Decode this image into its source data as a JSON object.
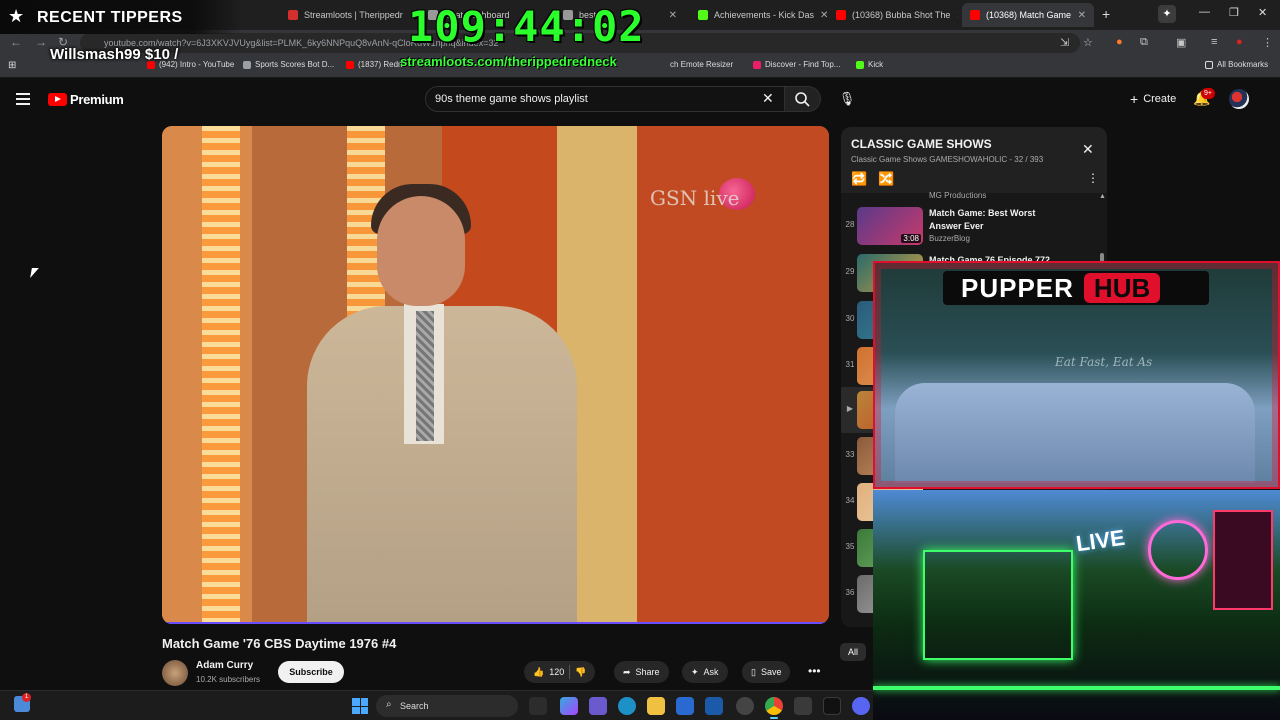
{
  "browser": {
    "tabs": [
      {
        "title": "Streamloots | Therippedr",
        "color": "#d32f2f",
        "active": false
      },
      {
        "title": "Chat  Dashboard",
        "color": "#999999",
        "active": false
      },
      {
        "title": "best C",
        "color": "#999999",
        "active": false
      },
      {
        "title": "Achievements - Kick Das",
        "color": "#53fc18",
        "active": false
      },
      {
        "title": "(10368) Bubba Shot The",
        "color": "#ff0000",
        "active": false
      },
      {
        "title": "(10368) Match Game",
        "color": "#ff0000",
        "active": true
      }
    ],
    "url": "youtube.com/watch?v=6J3XKVJVUyg&list=PLMK_6ky6NNPquQ8vAnN-qCloRdW1npnq&index=32",
    "bookmarks": [
      {
        "label": "(942) Intro - YouTube",
        "color": "#ff0000"
      },
      {
        "label": "Sports Scores Bot D...",
        "color": "#9aa0a6"
      },
      {
        "label": "(1837) Redm",
        "color": "#ff0000"
      },
      {
        "label": "ch Emote Resizer",
        "color": "#9aa0a6"
      },
      {
        "label": "Discover - Find Top...",
        "color": "#e91e63"
      },
      {
        "label": "Kick",
        "color": "#53fc18"
      }
    ],
    "all_bookmarks": "All Bookmarks"
  },
  "youtube": {
    "brand": "Premium",
    "search_value": "90s theme game shows playlist",
    "create_label": "Create",
    "notif_count": "9+"
  },
  "video": {
    "title": "Match Game '76 CBS Daytime 1976 #4",
    "watermark": "GSN live",
    "channel": "Adam Curry",
    "subscribers": "10.2K subscribers",
    "subscribe_label": "Subscribe",
    "likes": "120",
    "share_label": "Share",
    "ask_label": "Ask",
    "save_label": "Save"
  },
  "playlist": {
    "title": "CLASSIC GAME SHOWS",
    "subtitle": "Classic Game Shows GAMESHOWAHOLIC - 32 / 393",
    "partial_channel": "MG Productions",
    "items": [
      {
        "index": "28",
        "title": "Match Game: Best Worst Answer Ever",
        "channel": "BuzzerBlog",
        "duration": "3:08"
      },
      {
        "index": "29",
        "title": "Match Game 76 Episode 772",
        "channel": "",
        "duration": ""
      },
      {
        "index": "30",
        "title": "",
        "channel": "",
        "duration": ""
      },
      {
        "index": "31",
        "title": "",
        "channel": "",
        "duration": ""
      },
      {
        "index": "▶",
        "title": "",
        "channel": "",
        "duration": ""
      },
      {
        "index": "33",
        "title": "",
        "channel": "",
        "duration": ""
      },
      {
        "index": "34",
        "title": "",
        "channel": "",
        "duration": ""
      },
      {
        "index": "35",
        "title": "",
        "channel": "",
        "duration": ""
      },
      {
        "index": "36",
        "title": "",
        "channel": "",
        "duration": ""
      }
    ],
    "all_chip": "All"
  },
  "overlay": {
    "recent_tippers_label": "RECENT TIPPERS",
    "latest_tip": "Willsmash99 $10 /",
    "timer": "109:44:02",
    "streamloots_url": "streamloots.com/therippedredneck",
    "pupper": "PUPPER",
    "hub": "HUB",
    "wall_text": "Eat Fast, Eat As",
    "room_live": "LIVE"
  },
  "taskbar": {
    "search_placeholder": "Search",
    "widget_badge": "1"
  }
}
